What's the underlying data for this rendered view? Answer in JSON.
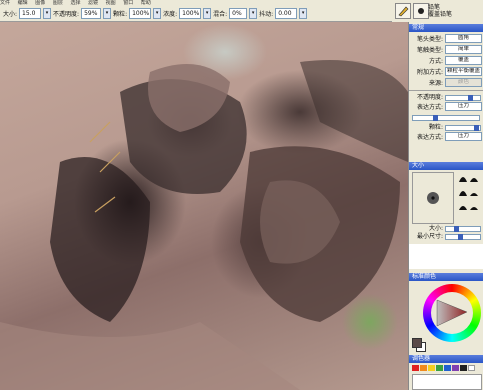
{
  "menubar": {
    "items": [
      "文件",
      "编辑",
      "图像",
      "图层",
      "选择",
      "滤镜",
      "视图",
      "窗口",
      "帮助"
    ]
  },
  "optbar": {
    "size_label": "大小:",
    "size_value": "15.0",
    "opacity_label": "不透明度:",
    "opacity_value": "59%",
    "grain_label": "颗粒:",
    "grain_value": "100%",
    "resaturation_label": "浓度:",
    "resaturation_value": "100%",
    "blend_label": "混合:",
    "blend_value": "0%",
    "jitter_label": "抖动:",
    "jitter_value": "0.00"
  },
  "toolhdr": {
    "category": "铅笔",
    "variant": "覆盖铅笔"
  },
  "panel": {
    "stroke_title": "常规",
    "rows": [
      {
        "k": "笔头类型:",
        "v": "圆角"
      },
      {
        "k": "笔触类型:",
        "v": "简单"
      },
      {
        "k": "方式:",
        "v": "覆盖"
      },
      {
        "k": "附加方式:",
        "v": "颗粒平衡覆盖"
      },
      {
        "k": "来源:",
        "v": "颜色"
      }
    ],
    "opacity_label": "不透明度:",
    "expression_label": "表达方式:",
    "expression_value": "压力",
    "grain_label": "颗粒:",
    "expression2_label": "表达方式:",
    "expression2_value": "压力",
    "size_title": "大小",
    "size_label": "大小:",
    "min_size_label": "最小尺寸:",
    "color_title": "标准颜色",
    "mixer_title": "调色器"
  },
  "colors": {
    "accent": "#2a56c6",
    "swatch": [
      "#e02020",
      "#f08a1c",
      "#f4d020",
      "#3aa040",
      "#2060d0",
      "#8040b0",
      "#202020",
      "#ffffff"
    ]
  }
}
